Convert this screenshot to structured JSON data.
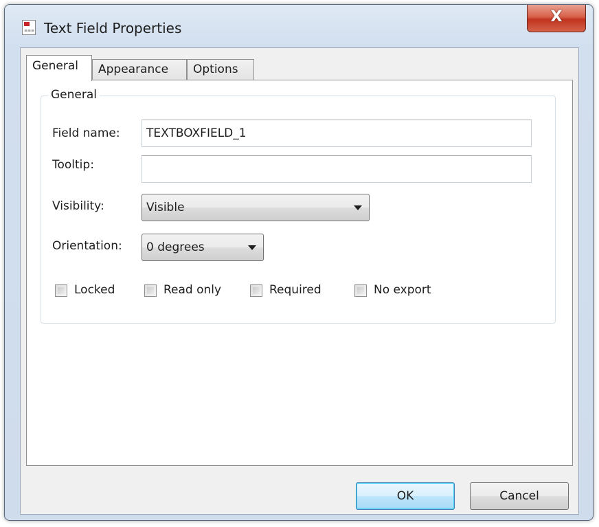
{
  "window": {
    "title": "Text Field Properties",
    "close_symbol": "X"
  },
  "tabs": [
    {
      "label": "General",
      "active": true
    },
    {
      "label": "Appearance",
      "active": false
    },
    {
      "label": "Options",
      "active": false
    }
  ],
  "general_group": {
    "title": "General",
    "field_name_label": "Field name:",
    "field_name_value": "TEXTBOXFIELD_1",
    "tooltip_label": "Tooltip:",
    "tooltip_value": "",
    "visibility_label": "Visibility:",
    "visibility_value": "Visible",
    "orientation_label": "Orientation:",
    "orientation_value": "0 degrees",
    "checkboxes": [
      {
        "label": "Locked",
        "checked": false
      },
      {
        "label": "Read only",
        "checked": false
      },
      {
        "label": "Required",
        "checked": false
      },
      {
        "label": "No export",
        "checked": false
      }
    ]
  },
  "buttons": {
    "ok": "OK",
    "cancel": "Cancel"
  },
  "icons": {
    "app": "document-icon",
    "close": "close-icon",
    "dropdown": "chevron-down-icon"
  },
  "colors": {
    "close_button": "#c8412c",
    "ok_button_border": "#3c7fb1",
    "dialog_background": "#f0f0f0"
  }
}
